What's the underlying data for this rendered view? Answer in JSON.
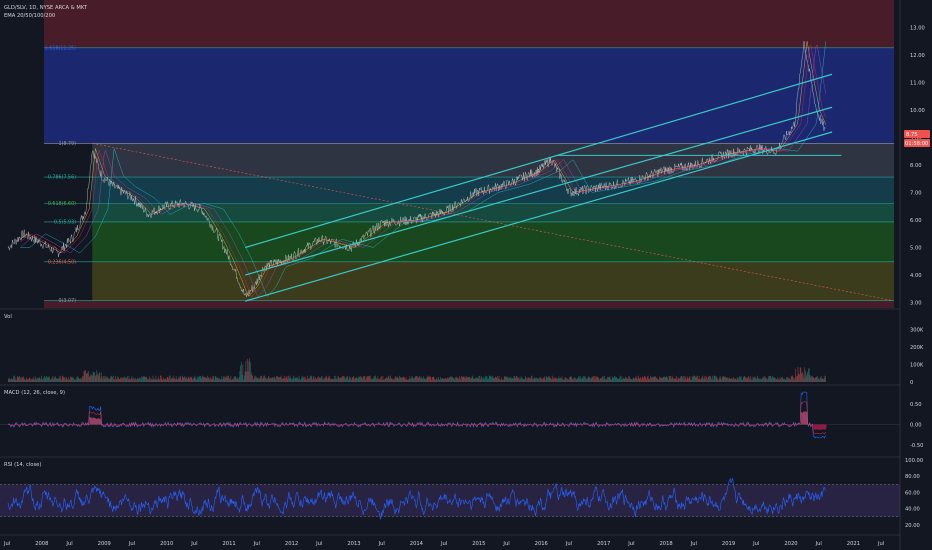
{
  "header": {
    "symbol": "GLD/SLV, 1D, NYSE ARCA & MKT",
    "indicator": "EMA 20/50/100/200"
  },
  "panes": {
    "volume_label": "Vol",
    "macd_label": "MACD (12, 26, close, 9)",
    "rsi_label": "RSI (14, close)"
  },
  "price_tags": {
    "last": "8.75",
    "countdown": "01:58:00"
  },
  "colors": {
    "background": "#131722",
    "up": "#26a69a",
    "down": "#ef5350",
    "channel": "#3ac7c7",
    "macd": "#2962ff",
    "signal": "#f23645",
    "rsi": "#2962ff"
  },
  "chart_data": [
    {
      "type": "line",
      "pane": "price",
      "ylim": [
        2.8,
        14.0
      ],
      "y_ticks": [
        "13.00",
        "12.00",
        "11.00",
        "10.00",
        "9.00",
        "8.00",
        "7.00",
        "6.00",
        "5.00",
        "4.00",
        "3.00"
      ],
      "x_ticks": [
        "Jul",
        "2008",
        "Jul",
        "2009",
        "Jul",
        "2010",
        "Jul",
        "2011",
        "Jul",
        "2012",
        "Jul",
        "2013",
        "Jul",
        "2014",
        "Jul",
        "2015",
        "Jul",
        "2016",
        "Jul",
        "2017",
        "Jul",
        "2018",
        "Jul",
        "2019",
        "Jul",
        "2020",
        "Jul",
        "2021",
        "Jul"
      ],
      "series": [
        {
          "values": [
            [
              2007.5,
              5.0
            ],
            [
              2007.75,
              5.5
            ],
            [
              2008.0,
              5.2
            ],
            [
              2008.3,
              4.8
            ],
            [
              2008.55,
              5.4
            ],
            [
              2008.75,
              6.4
            ],
            [
              2008.85,
              8.6
            ],
            [
              2009.0,
              7.6
            ],
            [
              2009.2,
              7.2
            ],
            [
              2009.5,
              6.8
            ],
            [
              2009.75,
              6.2
            ],
            [
              2010.0,
              6.5
            ],
            [
              2010.3,
              6.6
            ],
            [
              2010.6,
              6.4
            ],
            [
              2010.85,
              5.5
            ],
            [
              2011.05,
              4.6
            ],
            [
              2011.2,
              3.8
            ],
            [
              2011.3,
              3.2
            ],
            [
              2011.45,
              3.6
            ],
            [
              2011.6,
              4.3
            ],
            [
              2012.0,
              4.6
            ],
            [
              2012.5,
              5.3
            ],
            [
              2013.0,
              5.0
            ],
            [
              2013.5,
              5.9
            ],
            [
              2014.0,
              6.0
            ],
            [
              2014.5,
              6.3
            ],
            [
              2015.0,
              7.0
            ],
            [
              2015.5,
              7.3
            ],
            [
              2016.0,
              7.8
            ],
            [
              2016.2,
              8.2
            ],
            [
              2016.5,
              7.0
            ],
            [
              2017.0,
              7.2
            ],
            [
              2017.5,
              7.4
            ],
            [
              2018.0,
              7.8
            ],
            [
              2018.5,
              8.0
            ],
            [
              2019.0,
              8.4
            ],
            [
              2019.5,
              8.6
            ],
            [
              2019.8,
              8.5
            ],
            [
              2020.1,
              9.5
            ],
            [
              2020.25,
              12.5
            ],
            [
              2020.35,
              11.2
            ],
            [
              2020.45,
              10.0
            ],
            [
              2020.6,
              9.2
            ]
          ]
        }
      ],
      "fib_levels": [
        {
          "label": "1.618(11.25)",
          "value": 12.26
        },
        {
          "label": "1(8.79)",
          "value": 8.79
        },
        {
          "label": "0.786(7.56)",
          "value": 7.56
        },
        {
          "label": "0.618(6.60)",
          "value": 6.6
        },
        {
          "label": "0.5(5.93)",
          "value": 5.93
        },
        {
          "label": "0.236(4.50)",
          "value": 4.48
        },
        {
          "label": "0(3.07)",
          "value": 3.07
        }
      ],
      "channel": {
        "start": 2011.3,
        "end": 2020.7,
        "lines": [
          {
            "y_start": 5.0,
            "y_end": 11.3
          },
          {
            "y_start": 4.0,
            "y_end": 10.1
          },
          {
            "y_start": 3.05,
            "y_end": 9.2
          }
        ]
      },
      "horizontal_line": {
        "start": 2016.3,
        "end": 2020.85,
        "value": 8.35
      }
    },
    {
      "type": "bar",
      "pane": "volume",
      "y_ticks": [
        "300K",
        "200K",
        "100K",
        "0"
      ],
      "ylim": [
        0,
        400
      ]
    },
    {
      "type": "line",
      "pane": "macd",
      "y_ticks": [
        "0.50",
        "0.00",
        "-0.50"
      ],
      "ylim": [
        -0.75,
        0.9
      ]
    },
    {
      "type": "line",
      "pane": "rsi",
      "y_ticks": [
        "100.00",
        "80.00",
        "60.00",
        "40.00",
        "20.00"
      ],
      "ylim": [
        10,
        100
      ],
      "bands": [
        30,
        70
      ]
    }
  ]
}
